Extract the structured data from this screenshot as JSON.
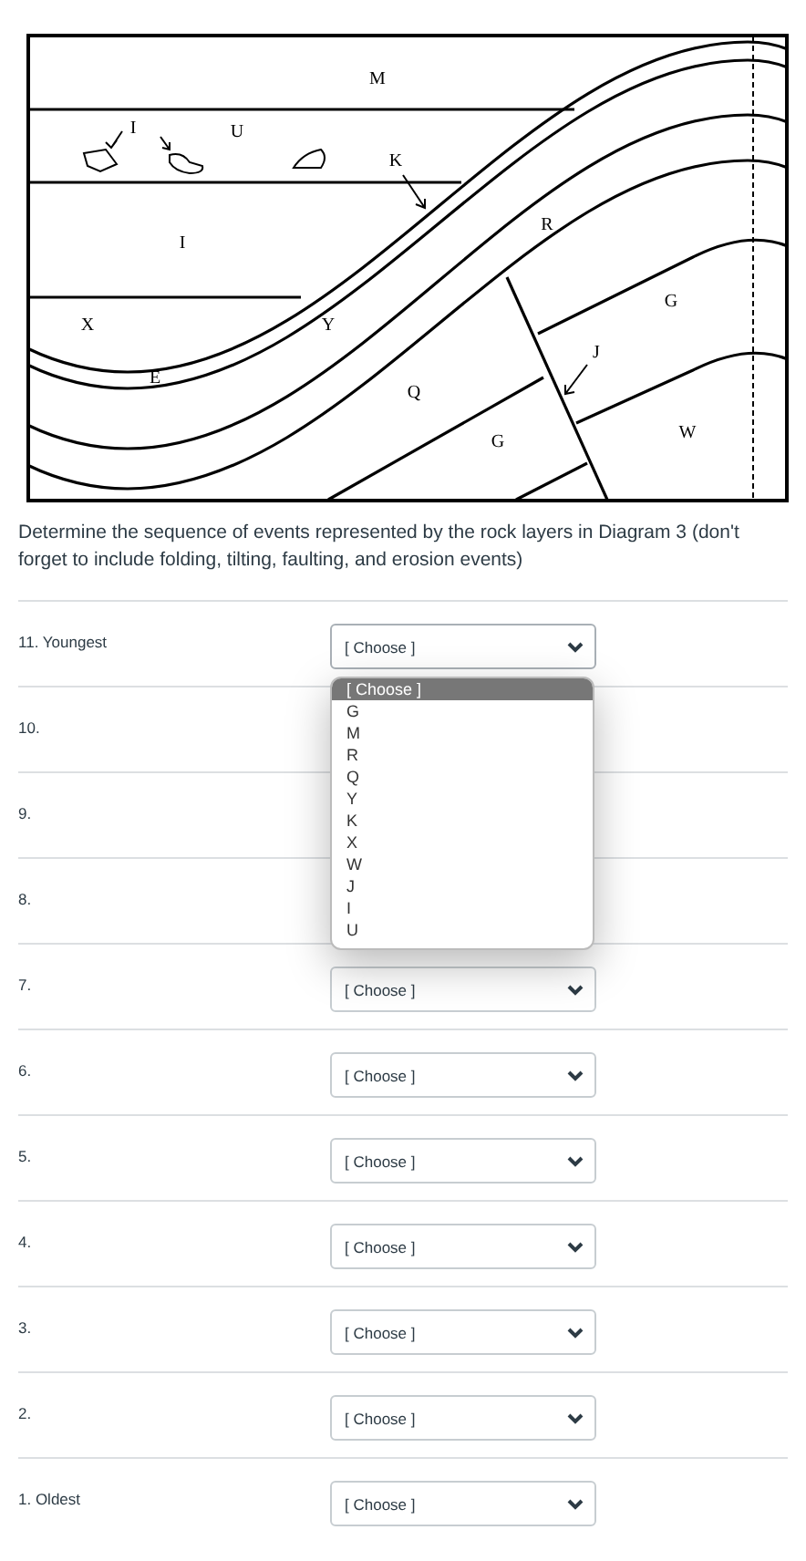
{
  "diagram": {
    "labels": [
      {
        "text": "M"
      },
      {
        "text": "I"
      },
      {
        "text": "U"
      },
      {
        "text": "K"
      },
      {
        "text": "I"
      },
      {
        "text": "R"
      },
      {
        "text": "X"
      },
      {
        "text": "Y"
      },
      {
        "text": "G"
      },
      {
        "text": "J"
      },
      {
        "text": "E"
      },
      {
        "text": "Q"
      },
      {
        "text": "G"
      },
      {
        "text": "W"
      }
    ]
  },
  "question": "Determine the sequence of events represented by the rock layers in Diagram 3 (don't forget to include folding, tilting, faulting, and erosion events)",
  "rows": [
    {
      "label": "11. Youngest",
      "select": {
        "value": "[ Choose ]",
        "open": true,
        "options": [
          {
            "label": "[ Choose ]",
            "selected": true
          },
          {
            "label": "G",
            "selected": false
          },
          {
            "label": "M",
            "selected": false
          },
          {
            "label": "R",
            "selected": false
          },
          {
            "label": "Q",
            "selected": false
          },
          {
            "label": "Y",
            "selected": false
          },
          {
            "label": "K",
            "selected": false
          },
          {
            "label": "X",
            "selected": false
          },
          {
            "label": "W",
            "selected": false
          },
          {
            "label": "J",
            "selected": false
          },
          {
            "label": "I",
            "selected": false
          },
          {
            "label": "U",
            "selected": false
          }
        ]
      }
    },
    {
      "label": "10."
    },
    {
      "label": "9."
    },
    {
      "label": "8."
    },
    {
      "label": "7.",
      "select": {
        "value": "[ Choose ]",
        "open": false
      }
    },
    {
      "label": "6.",
      "select": {
        "value": "[ Choose ]",
        "open": false
      }
    },
    {
      "label": "5.",
      "select": {
        "value": "[ Choose ]",
        "open": false
      }
    },
    {
      "label": "4.",
      "select": {
        "value": "[ Choose ]",
        "open": false
      }
    },
    {
      "label": "3.",
      "select": {
        "value": "[ Choose ]",
        "open": false
      }
    },
    {
      "label": "2.",
      "select": {
        "value": "[ Choose ]",
        "open": false
      }
    },
    {
      "label": "1. Oldest",
      "select": {
        "value": "[ Choose ]",
        "open": false
      }
    }
  ]
}
